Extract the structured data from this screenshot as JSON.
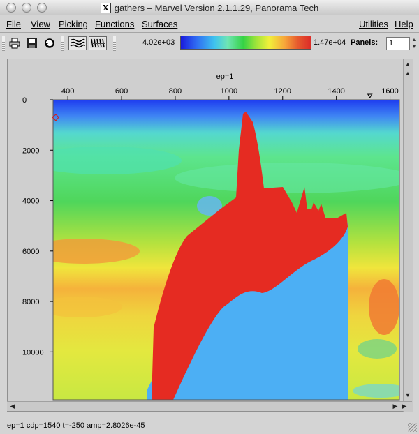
{
  "window": {
    "title": "gathers – Marvel Version 2.1.1.29, Panorama Tech"
  },
  "menu": {
    "file": "File",
    "view": "View",
    "picking": "Picking",
    "functions": "Functions",
    "surfaces": "Surfaces",
    "utilities": "Utilities",
    "help": "Help"
  },
  "toolbar": {
    "color_min": "4.02e+03",
    "color_max": "1.47e+04",
    "panels_label": "Panels:",
    "panels_value": "1"
  },
  "plot": {
    "title": "ep=1",
    "x_ticks": [
      {
        "value": 400,
        "label": "400"
      },
      {
        "value": 600,
        "label": "600"
      },
      {
        "value": 800,
        "label": "800"
      },
      {
        "value": 1000,
        "label": "1000"
      },
      {
        "value": 1200,
        "label": "1200"
      },
      {
        "value": 1400,
        "label": "1400"
      },
      {
        "value": 1600,
        "label": "1600"
      }
    ],
    "y_ticks": [
      {
        "value": 0,
        "label": "0"
      },
      {
        "value": 2000,
        "label": "2000"
      },
      {
        "value": 4000,
        "label": "4000"
      },
      {
        "value": 6000,
        "label": "6000"
      },
      {
        "value": 8000,
        "label": "8000"
      },
      {
        "value": 10000,
        "label": "10000"
      }
    ],
    "x_range": [
      345,
      1635
    ],
    "y_range": [
      0,
      11900
    ],
    "pick_marker_x": 1525,
    "colors": {
      "salt": "#e52b22",
      "sediment": "#4caff4",
      "shallow": "#2255ee"
    }
  },
  "status": {
    "text": "ep=1  cdp=1540 t=-250 amp=2.8026e-45"
  }
}
